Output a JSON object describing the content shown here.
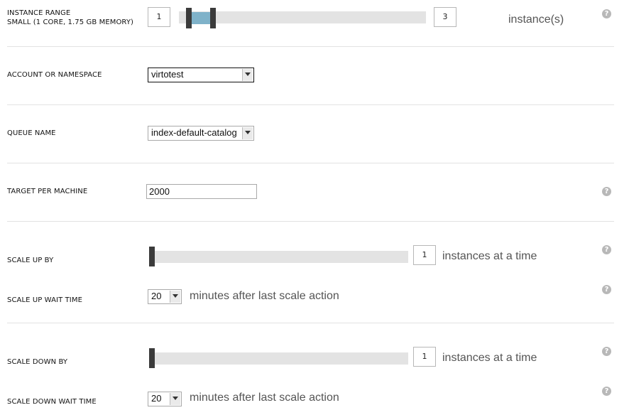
{
  "instance_range": {
    "label_line1": "INSTANCE RANGE",
    "label_line2": "SMALL (1 CORE, 1.75 GB MEMORY)",
    "min": "1",
    "max": "3",
    "unit": "instance(s)",
    "slider_low_fraction": 0.0,
    "slider_high_fraction": 1.0
  },
  "account": {
    "label": "ACCOUNT OR NAMESPACE",
    "value": "virtotest"
  },
  "queue": {
    "label": "QUEUE NAME",
    "value": "index-default-catalog"
  },
  "target": {
    "label": "TARGET PER MACHINE",
    "value": "2000"
  },
  "scale_up": {
    "by_label": "SCALE UP BY",
    "by_value": "1",
    "by_unit": "instances at a time",
    "wait_label": "SCALE UP WAIT TIME",
    "wait_value": "20",
    "wait_unit": "minutes after last scale action"
  },
  "scale_down": {
    "by_label": "SCALE DOWN BY",
    "by_value": "1",
    "by_unit": "instances at a time",
    "wait_label": "SCALE DOWN WAIT TIME",
    "wait_value": "20",
    "wait_unit": "minutes after last scale action"
  },
  "help_glyph": "?",
  "icons": [
    "help-icon",
    "chevron-down-icon"
  ]
}
